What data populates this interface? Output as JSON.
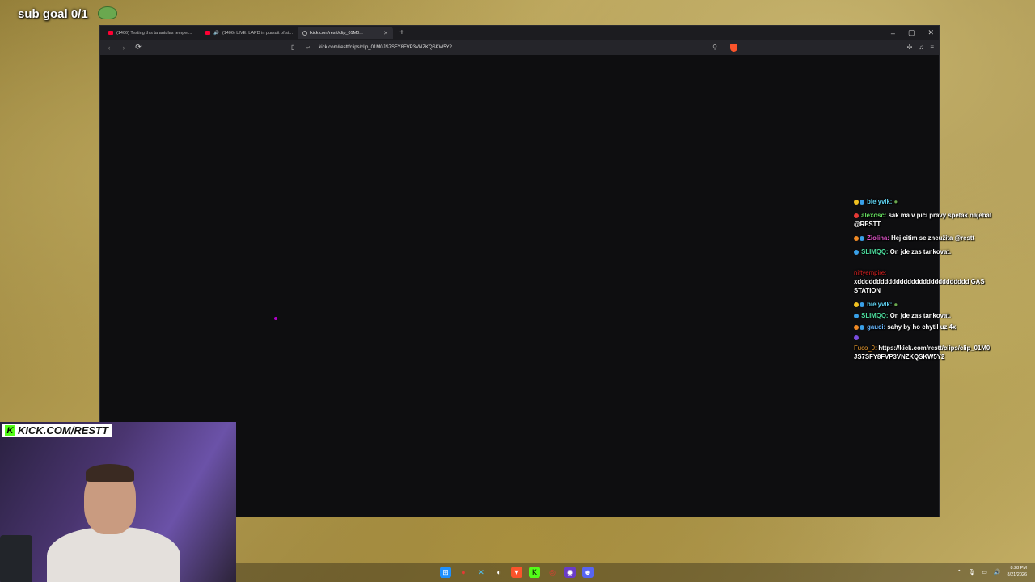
{
  "overlay": {
    "sub_goal": "sub goal 0/1"
  },
  "browser": {
    "tabs": [
      {
        "label": "(1406) Testing this tarantulas temper...",
        "favicon": "youtube-icon",
        "active": false
      },
      {
        "label": "(1406) LIVE: LAPD in pursuit of st...",
        "favicon": "youtube-icon",
        "active": false
      },
      {
        "label": "kick.com/restt/clip_01M0...",
        "favicon": "globe-icon",
        "active": true
      }
    ],
    "new_tab": "+",
    "url": "kick.com/restt/clips/clip_01M0JS7SFY8FVP3VNZKQSKW5Y2",
    "controls": {
      "minimize": "–",
      "maximize": "▢",
      "close": "✕"
    }
  },
  "chat": {
    "messages": [
      {
        "user": "bielyvlk:",
        "text": "",
        "color": "#5fd3f3"
      },
      {
        "user": "alexosc:",
        "text": "sak ma v pici pravy spetak najebal @RESTT",
        "color": "#66e060"
      },
      {
        "user": "Ziolina:",
        "text": "Hej citim se zneužita @restt",
        "color": "#e054c8"
      },
      {
        "user": "SLIMQQ:",
        "text": "On jde zas tankovat.",
        "color": "#4ee0a0"
      },
      {
        "user": "niftyempire:",
        "text": "xddddddddddddddddddddddddddddd GAS STATION",
        "color": "#e02020"
      },
      {
        "user": "bielyvlk:",
        "text": "",
        "color": "#5fd3f3"
      },
      {
        "user": "SLIMQQ:",
        "text": "On jde zas tankovat.",
        "color": "#4ee0a0"
      },
      {
        "user": "gauci:",
        "text": "sahy by ho chytil uz 4x",
        "color": "#68b8ff"
      },
      {
        "user": "Fuco_0:",
        "text": "https://kick.com/restt/clips/clip_01M0JS7SFY8FVP3VNZKQSKW5Y2",
        "color": "#f2a030"
      }
    ]
  },
  "webcam": {
    "label": "KICK.COM/RESTT",
    "k_letter": "K"
  },
  "taskbar": {
    "time": "8:28 PM",
    "date": "8/21/2026"
  }
}
